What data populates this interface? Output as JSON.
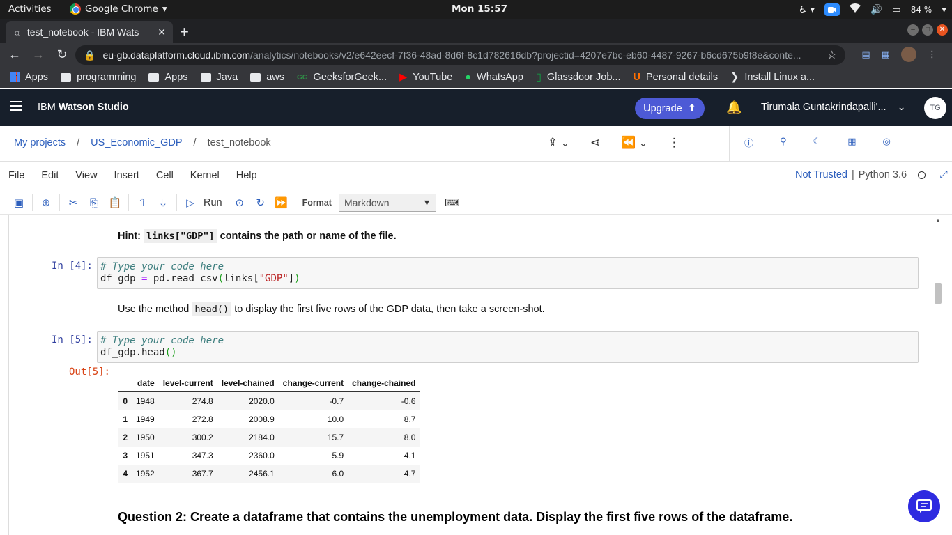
{
  "topbar": {
    "activities": "Activities",
    "app_name": "Google Chrome",
    "clock": "Mon 15:57",
    "battery": "84 %"
  },
  "browser": {
    "tab_title": "test_notebook - IBM Wats",
    "url_domain": "eu-gb.dataplatform.cloud.ibm.com",
    "url_path": "/analytics/notebooks/v2/e642eecf-7f36-48ad-8d6f-8c1d782616db?projectid=4207e7bc-eb60-4487-9267-b6cd675b9f8e&conte...",
    "bookmarks": [
      "Apps",
      "programming",
      "Apps",
      "Java",
      "aws",
      "GeeksforGeek...",
      "YouTube",
      "WhatsApp",
      "Glassdoor Job...",
      "Personal details",
      "Install Linux a..."
    ]
  },
  "watson": {
    "brand_prefix": "IBM",
    "brand_name": "Watson Studio",
    "upgrade_label": "Upgrade",
    "user_name": "Tirumala Guntakrindapalli'...",
    "user_initials": "TG",
    "breadcrumbs": [
      "My projects",
      "US_Economic_GDP",
      "test_notebook"
    ],
    "breadcrumb_sep": "/"
  },
  "jupyter": {
    "menus": [
      "File",
      "Edit",
      "View",
      "Insert",
      "Cell",
      "Kernel",
      "Help"
    ],
    "trust_status": "Not Trusted",
    "kernel": "Python 3.6",
    "run_label": "Run",
    "format_label": "Format",
    "format_value": "Markdown"
  },
  "notebook": {
    "hint_prefix": "Hint:",
    "hint_code": "links[\"GDP\"]",
    "hint_suffix": "contains the path or name of the file.",
    "cell4_prompt": "In [4]:",
    "cell4_comment": "# Type your code here",
    "cell4_var": "df_gdp ",
    "cell4_op": "=",
    "cell4_call": " pd.read_csv",
    "cell4_arg": "links[",
    "cell4_str": "\"GDP\"",
    "cell4_close": "]",
    "md2_prefix": "Use the method",
    "md2_code": "head()",
    "md2_suffix": "to display the first five rows of the GDP data, then take a screen-shot.",
    "cell5_prompt": "In [5]:",
    "cell5_comment": "# Type your code here",
    "cell5_code": "df_gdp.head",
    "out5_prompt": "Out[5]:",
    "table_headers": [
      "",
      "date",
      "level-current",
      "level-chained",
      "change-current",
      "change-chained"
    ],
    "table_rows": [
      [
        "0",
        "1948",
        "274.8",
        "2020.0",
        "-0.7",
        "-0.6"
      ],
      [
        "1",
        "1949",
        "272.8",
        "2008.9",
        "10.0",
        "8.7"
      ],
      [
        "2",
        "1950",
        "300.2",
        "2184.0",
        "15.7",
        "8.0"
      ],
      [
        "3",
        "1951",
        "347.3",
        "2360.0",
        "5.9",
        "4.1"
      ],
      [
        "4",
        "1952",
        "367.7",
        "2456.1",
        "6.0",
        "4.7"
      ]
    ],
    "question2": "Question 2: Create a dataframe that contains the unemployment data. Display the first five rows of the dataframe."
  }
}
